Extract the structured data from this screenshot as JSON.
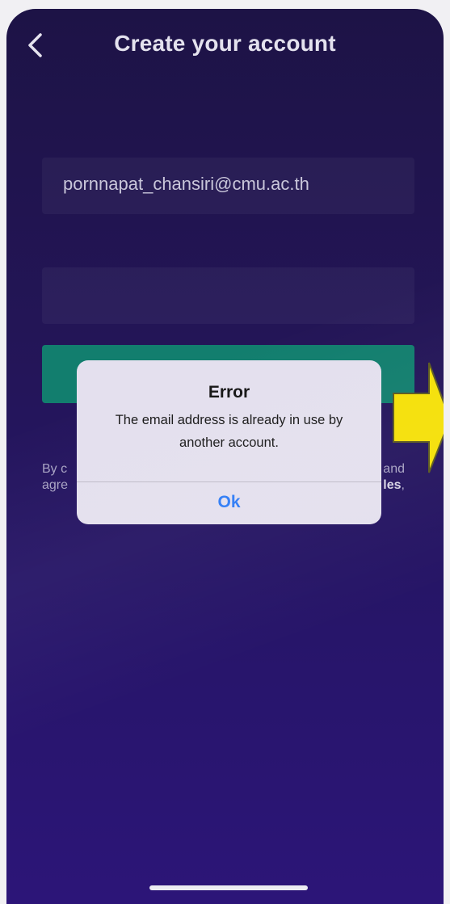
{
  "header": {
    "title": "Create your account"
  },
  "form": {
    "email_value": "pornnapat_chansiri@cmu.ac.th",
    "password_value": ""
  },
  "terms": {
    "line1_left": "By c",
    "line1_right": "and",
    "line2_left": "agre",
    "line2_right": "les",
    "line2_comma": ","
  },
  "dialog": {
    "title": "Error",
    "message": "The email address is already in use by another account.",
    "ok_label": "Ok"
  },
  "colors": {
    "background": "#231556",
    "primary_button": "#127e6e",
    "dialog_action": "#2f7cf6",
    "annotation_arrow": "#f5e008"
  },
  "icons": {
    "back": "chevron-left-icon",
    "annotation": "arrow-annotation"
  }
}
